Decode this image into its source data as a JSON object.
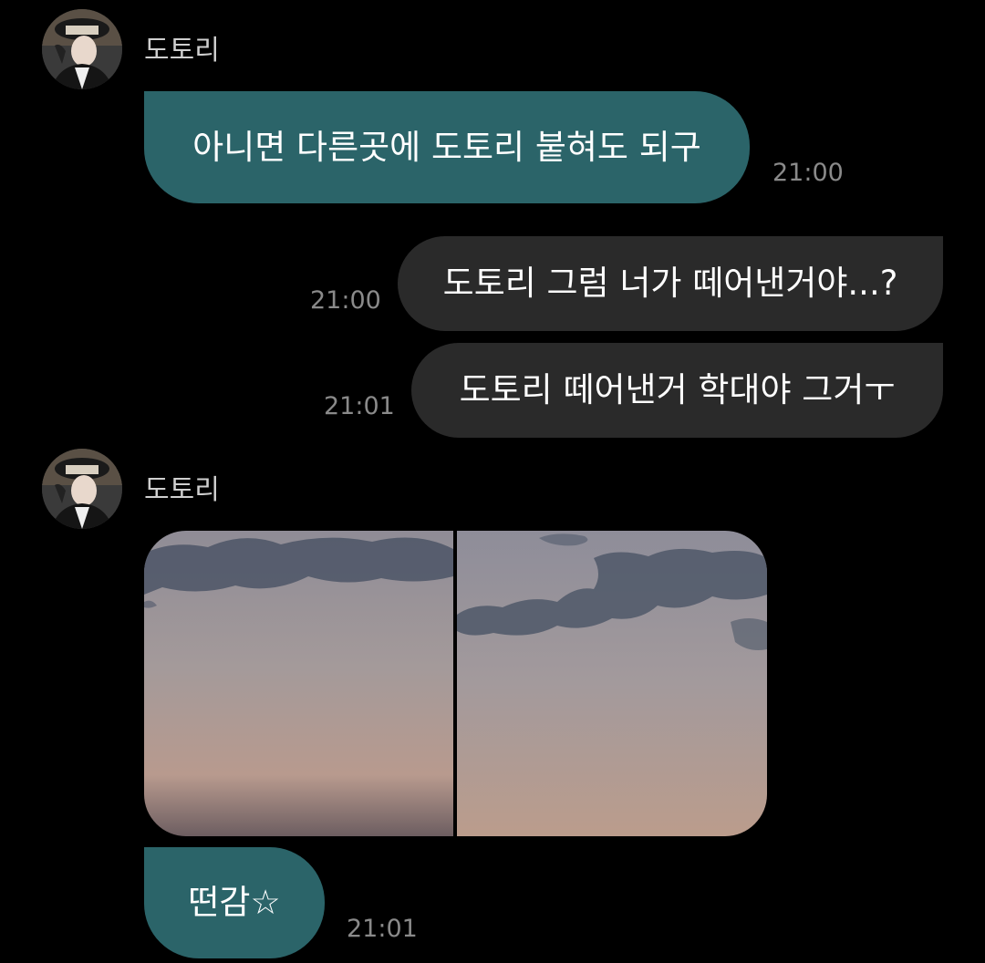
{
  "chat": {
    "groups": [
      {
        "sender_name": "도토리",
        "avatar_icon": "user-avatar-icon"
      },
      {
        "sender_name": "도토리",
        "avatar_icon": "user-avatar-icon"
      }
    ],
    "messages": [
      {
        "direction": "received",
        "text": "아니면 다른곳에 도토리 붙혀도 되구",
        "time": "21:00"
      },
      {
        "direction": "sent",
        "text": "도토리 그럼 너가 떼어낸거야...?",
        "time": "21:00"
      },
      {
        "direction": "sent",
        "text": "도토리 떼어낸거 학대야 그거ㅜ",
        "time": "21:01"
      },
      {
        "direction": "received",
        "type": "photo-pair",
        "photos": [
          "sky-photo",
          "sky-photo"
        ]
      },
      {
        "direction": "received",
        "text": "떤감☆",
        "time": "21:01"
      }
    ]
  },
  "colors": {
    "background": "#000000",
    "received_bubble": "#2b6469",
    "sent_bubble": "#2a2a2a",
    "timestamp": "#8a8a8a",
    "sender_name": "#cfcfcf"
  }
}
